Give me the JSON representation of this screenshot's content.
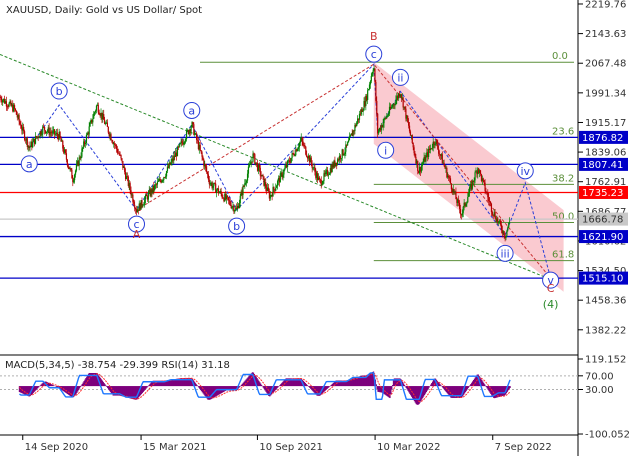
{
  "chart_data": [
    {
      "type": "candlestick",
      "title": "XAUUSD, Daily:  Gold vs US Dollar/ Spot",
      "ylim": [
        1320,
        2230
      ],
      "y_ticks": [
        "2219.76",
        "2143.63",
        "2067.48",
        "1991.34",
        "1915.17",
        "1839.06",
        "1762.91",
        "1686.77",
        "1610.62",
        "1534.50",
        "1458.36",
        "1382.22"
      ],
      "x_ticks": [
        "14 Sep 2020",
        "15 Mar 2021",
        "10 Sep 2021",
        "10 Mar 2022",
        "7 Sep 2022"
      ],
      "x_tick_dates": [
        "2020-09-14",
        "2021-03-15",
        "2021-09-10",
        "2022-03-10",
        "2022-09-07"
      ],
      "x_range": [
        "2020-08-10",
        "2023-01-10"
      ],
      "price_path_approx": [
        [
          "2020-08-10",
          1980
        ],
        [
          "2020-09-01",
          1950
        ],
        [
          "2020-09-24",
          1850
        ],
        [
          "2020-10-15",
          1900
        ],
        [
          "2020-11-09",
          1880
        ],
        [
          "2020-11-30",
          1770
        ],
        [
          "2021-01-06",
          1960
        ],
        [
          "2021-02-10",
          1830
        ],
        [
          "2021-03-08",
          1690
        ],
        [
          "2021-04-20",
          1780
        ],
        [
          "2021-06-01",
          1910
        ],
        [
          "2021-06-29",
          1760
        ],
        [
          "2021-08-09",
          1690
        ],
        [
          "2021-09-03",
          1830
        ],
        [
          "2021-09-29",
          1725
        ],
        [
          "2021-11-16",
          1870
        ],
        [
          "2021-12-15",
          1760
        ],
        [
          "2022-01-25",
          1850
        ],
        [
          "2022-02-24",
          1975
        ],
        [
          "2022-03-08",
          2065
        ],
        [
          "2022-03-14",
          1890
        ],
        [
          "2022-04-18",
          1995
        ],
        [
          "2022-05-16",
          1790
        ],
        [
          "2022-06-10",
          1870
        ],
        [
          "2022-07-21",
          1680
        ],
        [
          "2022-08-15",
          1800
        ],
        [
          "2022-09-06",
          1690
        ],
        [
          "2022-09-26",
          1625
        ],
        [
          "2022-10-04",
          1665
        ]
      ],
      "horizontal_levels": [
        {
          "value": "1876.82",
          "color": "#0000c8"
        },
        {
          "value": "1807.41",
          "color": "#0000c8"
        },
        {
          "value": "1735.23",
          "color": "#ff0000"
        },
        {
          "value": "1666.78",
          "color": "#c8c8c8"
        },
        {
          "value": "1621.90",
          "color": "#0000c8"
        },
        {
          "value": "1515.10",
          "color": "#0000c8"
        }
      ],
      "fibonacci_levels": [
        "0.0",
        "23.6",
        "38.2",
        "50.0",
        "61.8"
      ],
      "fibonacci_values": [
        2070,
        1876.82,
        1756,
        1658,
        1560
      ],
      "wave_labels": {
        "minor_blue": [
          {
            "label": "a",
            "date": "2020-09-24",
            "price": 1850
          },
          {
            "label": "b",
            "date": "2020-11-09",
            "price": 1960
          },
          {
            "label": "c",
            "date": "2021-03-08",
            "price": 1690
          },
          {
            "label": "a",
            "date": "2021-06-01",
            "price": 1910
          },
          {
            "label": "b",
            "date": "2021-08-09",
            "price": 1690
          },
          {
            "label": "c",
            "date": "2022-03-08",
            "price": 2065
          },
          {
            "label": "i",
            "date": "2022-03-14",
            "price": 1890
          },
          {
            "label": "ii",
            "date": "2022-04-18",
            "price": 1995
          },
          {
            "label": "iii",
            "date": "2022-09-26",
            "price": 1625
          },
          {
            "label": "iv",
            "date": "2022-10-27",
            "price": 1760
          },
          {
            "label": "v",
            "date": "2022-12-05",
            "price": 1515
          }
        ],
        "major_red": [
          {
            "label": "A",
            "date": "2021-03-08",
            "price": 1690
          },
          {
            "label": "B",
            "date": "2022-03-08",
            "price": 2065
          },
          {
            "label": "C",
            "date": "2022-12-05",
            "price": 1515
          }
        ],
        "green": [
          {
            "label": "(4)",
            "date": "2022-12-05",
            "price": 1515
          }
        ]
      },
      "grid": false
    },
    {
      "type": "histogram",
      "title": "MACD(5,34,5) -38.754 -29.399 RSI(14) 31.18",
      "ylim": [
        -100,
        125
      ],
      "y_ticks": [
        "119.152",
        "70.00",
        "30.00",
        "-100.052"
      ],
      "rsi_levels": [
        70,
        30
      ],
      "series": [
        {
          "name": "MACD",
          "color": "#7d007d"
        },
        {
          "name": "Signal",
          "color": "#ff3030"
        },
        {
          "name": "RSI",
          "color": "#1e78ff"
        }
      ]
    }
  ],
  "ui": {
    "header_title": "XAUUSD, Daily:  Gold vs US Dollar/ Spot",
    "indicator_title": "MACD(5,34,5) -38.754 -29.399 RSI(14) 31.18",
    "price_tags": [
      "1876.82",
      "1807.41",
      "1735.23",
      "1666.78",
      "1621.90",
      "1515.10"
    ]
  },
  "colors": {
    "bull": "#008000",
    "bear": "#b40000",
    "channel": "#f8b8c0",
    "fib": "#5b8f3a",
    "blue_level": "#0000c8",
    "red_level": "#ff0000",
    "wave_blue": "#2a3fd8",
    "wave_red": "#c83232",
    "wave_green": "#2a8a2a",
    "macd": "#7d007d",
    "signal": "#ff3030",
    "rsi": "#1e78ff"
  }
}
